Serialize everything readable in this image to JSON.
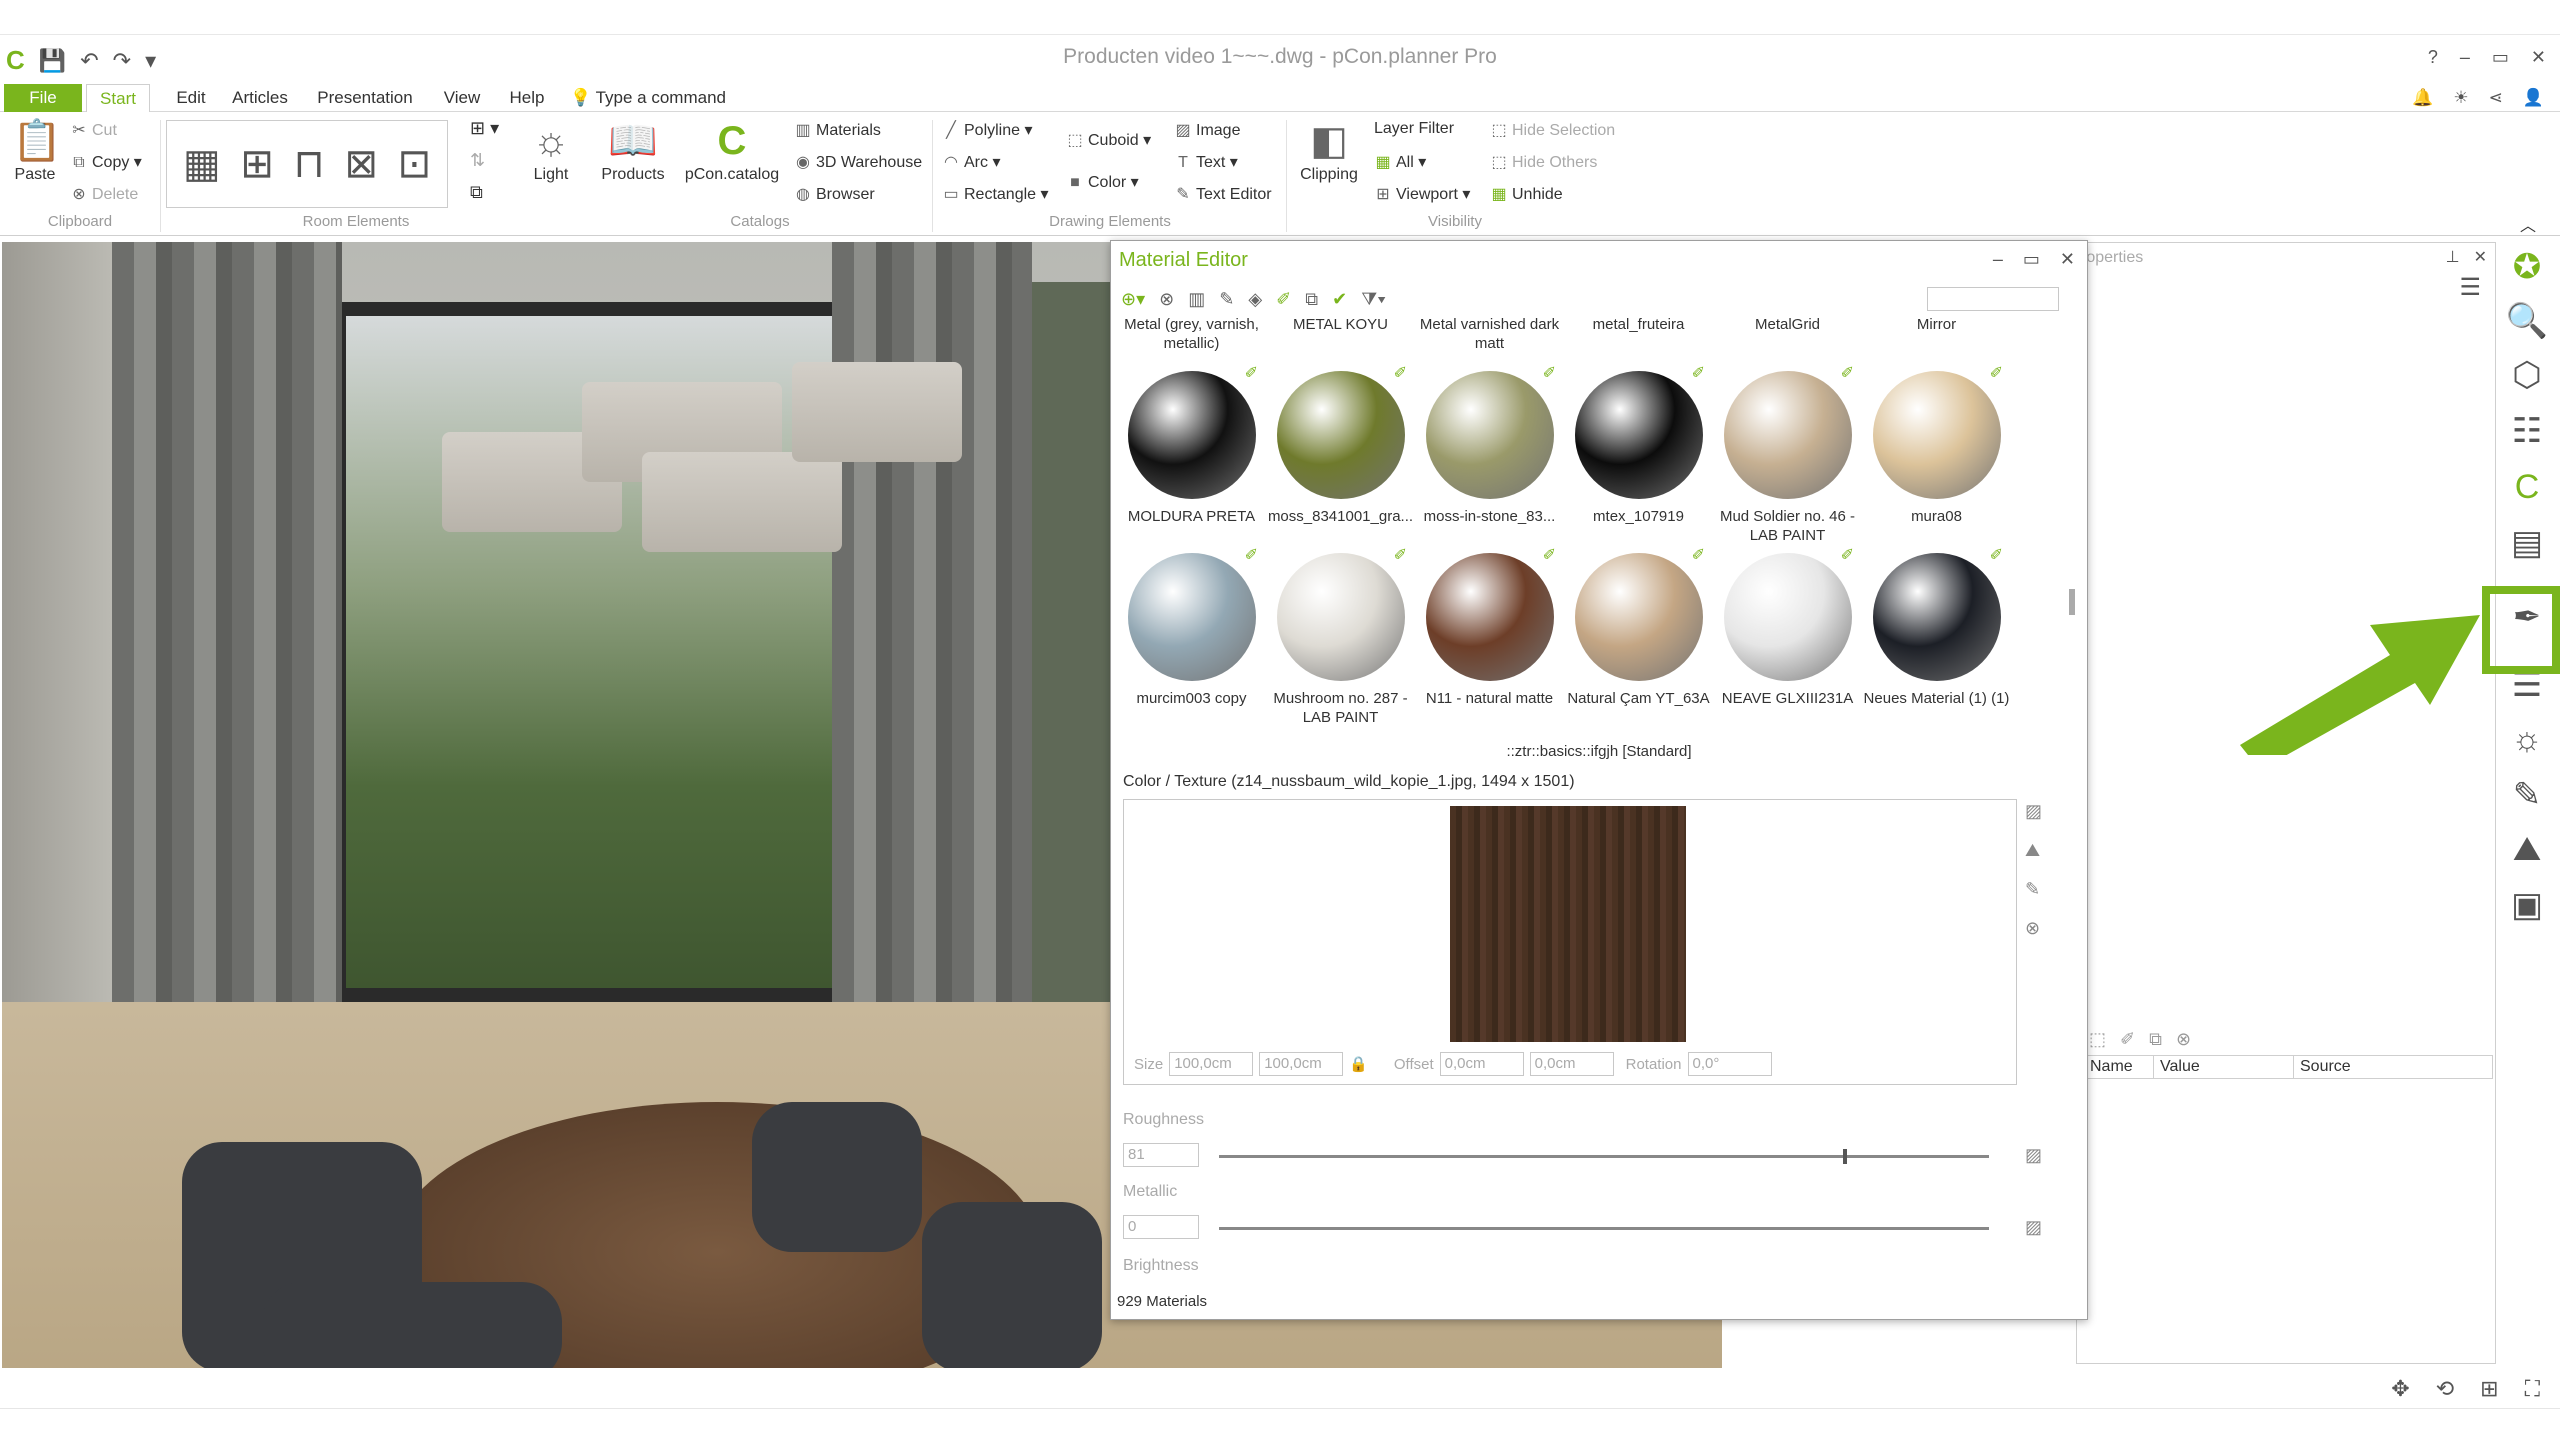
{
  "window": {
    "title": "Producten video 1~~~.dwg - pCon.planner Pro",
    "help": "?",
    "minimize": "–",
    "restore": "▭",
    "close": "✕"
  },
  "qat": {
    "logo": "C",
    "save": "💾",
    "undo": "↶",
    "redo": "↷",
    "more": "▾"
  },
  "menu": {
    "file": "File",
    "tabs": [
      "Start",
      "Edit",
      "Articles",
      "Presentation",
      "View",
      "Help"
    ],
    "command_placeholder": "Type a command",
    "right_icons": [
      "🔔",
      "☀",
      "⋖",
      "👤"
    ]
  },
  "ribbon": {
    "clipboard": {
      "paste": "Paste",
      "cut": "Cut",
      "copy": "Copy",
      "delete": "Delete",
      "label": "Clipboard"
    },
    "room_elements": {
      "label": "Room Elements"
    },
    "light": "Light",
    "products": "Products",
    "pcon_catalog": "pCon.catalog",
    "catalogs": {
      "materials": "Materials",
      "warehouse": "3D Warehouse",
      "browser": "Browser",
      "label": "Catalogs"
    },
    "drawing": {
      "polyline": "Polyline",
      "arc": "Arc",
      "rectangle": "Rectangle",
      "cuboid": "Cuboid",
      "color": "Color",
      "image": "Image",
      "text": "Text",
      "text_editor": "Text Editor",
      "label": "Drawing Elements"
    },
    "clipping": "Clipping",
    "visibility": {
      "layer_filter": "Layer Filter",
      "all": "All",
      "viewport": "Viewport",
      "hide_selection": "Hide Selection",
      "hide_others": "Hide Others",
      "unhide": "Unhide",
      "label": "Visibility"
    }
  },
  "material_editor": {
    "title": "Material Editor",
    "header_row": [
      "Metal (grey, varnish, metallic)",
      "METAL KOYU",
      "Metal varnished dark matt",
      "metal_fruteira",
      "MetalGrid",
      "Mirror"
    ],
    "row1": [
      {
        "name": "MOLDURA PRETA",
        "color": "#111111"
      },
      {
        "name": "moss_8341001_gra...",
        "color": "#6f7a2c"
      },
      {
        "name": "moss-in-stone_83...",
        "color": "#9a9a6a"
      },
      {
        "name": "mtex_107919",
        "color": "#0c0c0c"
      },
      {
        "name": "Mud Soldier no. 46 - LAB PAINT",
        "color": "#c6b092"
      },
      {
        "name": "mura08",
        "color": "#dcc39a"
      }
    ],
    "row2": [
      {
        "name": "murcim003 copy",
        "color": "#93a8b4"
      },
      {
        "name": "Mushroom no. 287 - LAB PAINT",
        "color": "#dedbd4"
      },
      {
        "name": "N11 - natural matte",
        "color": "#6d3e28"
      },
      {
        "name": "Natural Çam YT_63A",
        "color": "#c4a684"
      },
      {
        "name": "NEAVE GLXIII231A",
        "color": "#e6e6e6"
      },
      {
        "name": "Neues Material (1) (1)",
        "color": "#1c1f26"
      }
    ],
    "std_name": "::ztr::basics::ifgjh [Standard]",
    "color_texture": "Color / Texture   (z14_nussbaum_wild_kopie_1.jpg, 1494 x 1501)",
    "size_label": "Size",
    "size_w": "100,0cm",
    "size_h": "100,0cm",
    "offset_label": "Offset",
    "offset_x": "0,0cm",
    "offset_y": "0,0cm",
    "rotation_label": "Rotation",
    "rotation": "0,0°",
    "roughness_label": "Roughness",
    "roughness": "81",
    "roughness_level": 0.81,
    "metallic_label": "Metallic",
    "metallic": "0",
    "brightness_label": "Brightness",
    "status": "929 Materials"
  },
  "properties": {
    "title": "roperties",
    "columns": [
      "Name",
      "Value",
      "Source"
    ]
  },
  "colors": {
    "accent": "#7ab51d"
  }
}
